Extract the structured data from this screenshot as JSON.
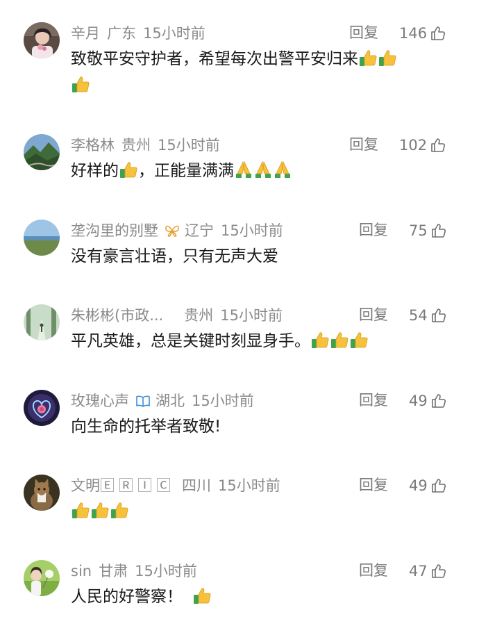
{
  "comments": [
    {
      "user": "辛月",
      "region": "广东",
      "time": "15小时前",
      "reply_label": "回复",
      "likes": "146",
      "text": "致敬平安守护者，希望每次出警平安归来",
      "emojis": [
        "thumbs-up",
        "thumbs-up",
        "thumbs-up"
      ],
      "avatar_icon": "girl-portrait-avatar"
    },
    {
      "user": "李格林",
      "region": "贵州",
      "time": "15小时前",
      "reply_label": "回复",
      "likes": "102",
      "text_before": "好样的",
      "text_after": "，正能量满满",
      "emojis_before": [
        "thumbs-up"
      ],
      "emojis_after": [
        "folded-hands",
        "folded-hands",
        "folded-hands"
      ],
      "avatar_icon": "mountain-landscape-avatar"
    },
    {
      "user": "垄沟里的别墅",
      "region": "辽宁",
      "time": "15小时前",
      "reply_label": "回复",
      "likes": "75",
      "text": "没有豪言壮语，只有无声大爱",
      "badge_icon": "butterfly-badge-icon",
      "badge_color": "#e9a23b",
      "avatar_icon": "lake-horizon-avatar"
    },
    {
      "user": "朱彬彬(市政...",
      "region": "贵州",
      "time": "15小时前",
      "reply_label": "回复",
      "likes": "54",
      "text": "平凡英雄，总是关键时刻显身手。",
      "emojis": [
        "thumbs-up",
        "thumbs-up",
        "thumbs-up"
      ],
      "avatar_icon": "forest-path-avatar"
    },
    {
      "user": "玫瑰心声",
      "region": "湖北",
      "time": "15小时前",
      "reply_label": "回复",
      "likes": "49",
      "text": "向生命的托举者致敬!",
      "badge_icon": "book-badge-icon",
      "badge_color": "#3b8fd8",
      "avatar_icon": "rose-heart-avatar"
    },
    {
      "user": "文明🄴🅁🄸🄲",
      "user_name": "文明",
      "user_suffix": "🄴🅁🄸🄲",
      "region": "四川",
      "time": "15小时前",
      "reply_label": "回复",
      "likes": "49",
      "text": "",
      "emojis": [
        "thumbs-up",
        "thumbs-up",
        "thumbs-up"
      ],
      "avatar_icon": "cat-avatar"
    },
    {
      "user": "sin",
      "region": "甘肃",
      "time": "15小时前",
      "reply_label": "回复",
      "likes": "47",
      "text": "人民的好警察！",
      "emojis": [
        "thumbs-up"
      ],
      "avatar_icon": "girl-dandelion-avatar"
    }
  ],
  "colors": {
    "meta_text": "#8a8a8a",
    "body_text": "#1a1a1a",
    "background": "#ffffff",
    "thumb_skin": "#f6c13b",
    "thumb_cuff": "#3fa34d"
  },
  "icons": {
    "like": "thumbs-up-outline-icon",
    "emoji_thumb": "thumbs-up-emoji-icon",
    "emoji_pray": "folded-hands-emoji-icon"
  }
}
